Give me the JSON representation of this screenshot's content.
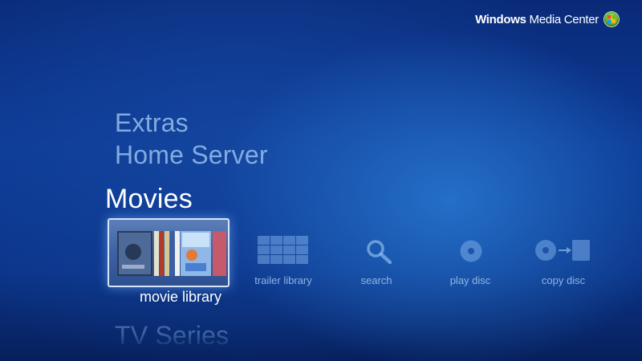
{
  "header": {
    "brand_bold": "Windows",
    "brand_rest": "Media Center"
  },
  "menu": {
    "items": [
      {
        "label": "Extras"
      },
      {
        "label": "Home Server"
      },
      {
        "label": "Movies",
        "selected": true
      },
      {
        "label": "TV Series"
      }
    ]
  },
  "strip": {
    "tiles": [
      {
        "label": "movie library",
        "icon": "movie-covers-icon",
        "selected": true
      },
      {
        "label": "trailer library",
        "icon": "grid-icon"
      },
      {
        "label": "search",
        "icon": "search-icon"
      },
      {
        "label": "play disc",
        "icon": "disc-icon"
      },
      {
        "label": "copy disc",
        "icon": "copy-disc-icon"
      }
    ]
  },
  "colors": {
    "background_top": "#0a2a78",
    "background_mid": "#0c3a95",
    "selected_text": "#ffffff",
    "dim_text": "#96bee9",
    "tile_border": "#dcebff"
  }
}
